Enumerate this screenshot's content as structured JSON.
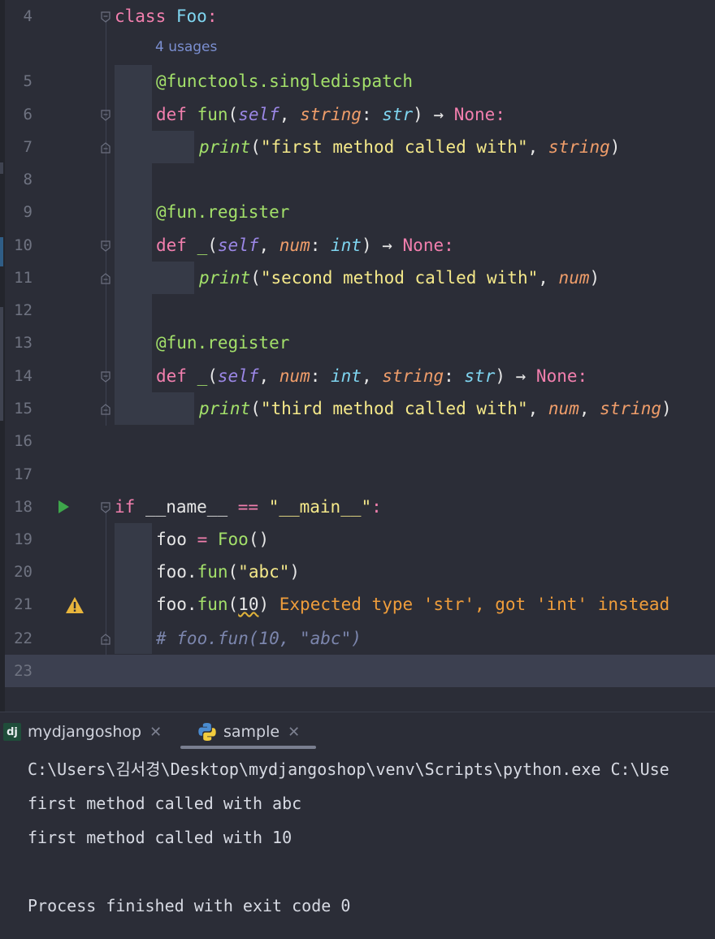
{
  "editor": {
    "usages_hint": "4 usages",
    "lines": [
      {
        "num": "4"
      },
      {
        "num": "5"
      },
      {
        "num": "6"
      },
      {
        "num": "7"
      },
      {
        "num": "8"
      },
      {
        "num": "9"
      },
      {
        "num": "10"
      },
      {
        "num": "11"
      },
      {
        "num": "12"
      },
      {
        "num": "13"
      },
      {
        "num": "14"
      },
      {
        "num": "15"
      },
      {
        "num": "16"
      },
      {
        "num": "17"
      },
      {
        "num": "18"
      },
      {
        "num": "19"
      },
      {
        "num": "20"
      },
      {
        "num": "21"
      },
      {
        "num": "22"
      },
      {
        "num": "23"
      }
    ],
    "code": {
      "l4_kw": "class",
      "l4_name": "Foo",
      "l4_colon": ":",
      "l5": "@functools.singledispatch",
      "l6_def": "def",
      "l6_fn": "fun",
      "l6_open": "(",
      "l6_self": "self",
      "l6_comma": ", ",
      "l6_param": "string",
      "l6_colon": ": ",
      "l6_type": "str",
      "l6_close": ") → ",
      "l6_none": "None",
      "l6_end": ":",
      "l7_print": "print",
      "l7_open": "(",
      "l7_str": "\"first method called with\"",
      "l7_comma": ", ",
      "l7_arg": "string",
      "l7_close": ")",
      "l9": "@fun.register",
      "l10_def": "def",
      "l10_fn": "_",
      "l10_open": "(",
      "l10_self": "self",
      "l10_comma": ", ",
      "l10_param": "num",
      "l10_colon": ": ",
      "l10_type": "int",
      "l10_close": ") → ",
      "l10_none": "None",
      "l10_end": ":",
      "l11_print": "print",
      "l11_open": "(",
      "l11_str": "\"second method called with\"",
      "l11_comma": ", ",
      "l11_arg": "num",
      "l11_close": ")",
      "l13": "@fun.register",
      "l14_def": "def",
      "l14_fn": "_",
      "l14_open": "(",
      "l14_self": "self",
      "l14_comma1": ", ",
      "l14_param1": "num",
      "l14_colon1": ": ",
      "l14_type1": "int",
      "l14_comma2": ", ",
      "l14_param2": "string",
      "l14_colon2": ": ",
      "l14_type2": "str",
      "l14_close": ") → ",
      "l14_none": "None",
      "l14_end": ":",
      "l15_print": "print",
      "l15_open": "(",
      "l15_str": "\"third method called with\"",
      "l15_comma1": ", ",
      "l15_arg1": "num",
      "l15_comma2": ", ",
      "l15_arg2": "string",
      "l15_close": ")",
      "l18_if": "if",
      "l18_mid": " __name__ ",
      "l18_eq": "==",
      "l18_sp": " ",
      "l18_str": "\"__main__\"",
      "l18_colon": ":",
      "l19_var": "foo ",
      "l19_eq": "=",
      "l19_sp": " ",
      "l19_cls": "Foo",
      "l19_call": "()",
      "l20_var": "foo.",
      "l20_fn": "fun",
      "l20_open": "(",
      "l20_str": "\"abc\"",
      "l20_close": ")",
      "l21_var": "foo.",
      "l21_fn": "fun",
      "l21_open": "(",
      "l21_arg": "10",
      "l21_close": ")",
      "l21_error": " Expected type 'str', got 'int' instead",
      "l22": "# foo.fun(10, \"abc\")"
    },
    "icons": {
      "run": "run-gutter-icon",
      "warning": "warning-icon",
      "fold": "fold-marker-icon"
    }
  },
  "run_panel": {
    "tabs": [
      {
        "label": "mydjangoshop",
        "icon": "django-icon",
        "close": "✕"
      },
      {
        "label": "sample",
        "icon": "python-icon",
        "close": "✕"
      }
    ],
    "output": [
      "C:\\Users\\김서경\\Desktop\\mydjangoshop\\venv\\Scripts\\python.exe C:\\Use",
      "first method called with abc",
      "first method called with 10",
      "",
      "Process finished with exit code 0"
    ]
  },
  "colors": {
    "background": "#2b2d37",
    "keyword": "#f27fae",
    "string": "#f5e98a",
    "function": "#a3e06a",
    "type": "#7fd5f0",
    "warning": "#ef9d3b"
  }
}
